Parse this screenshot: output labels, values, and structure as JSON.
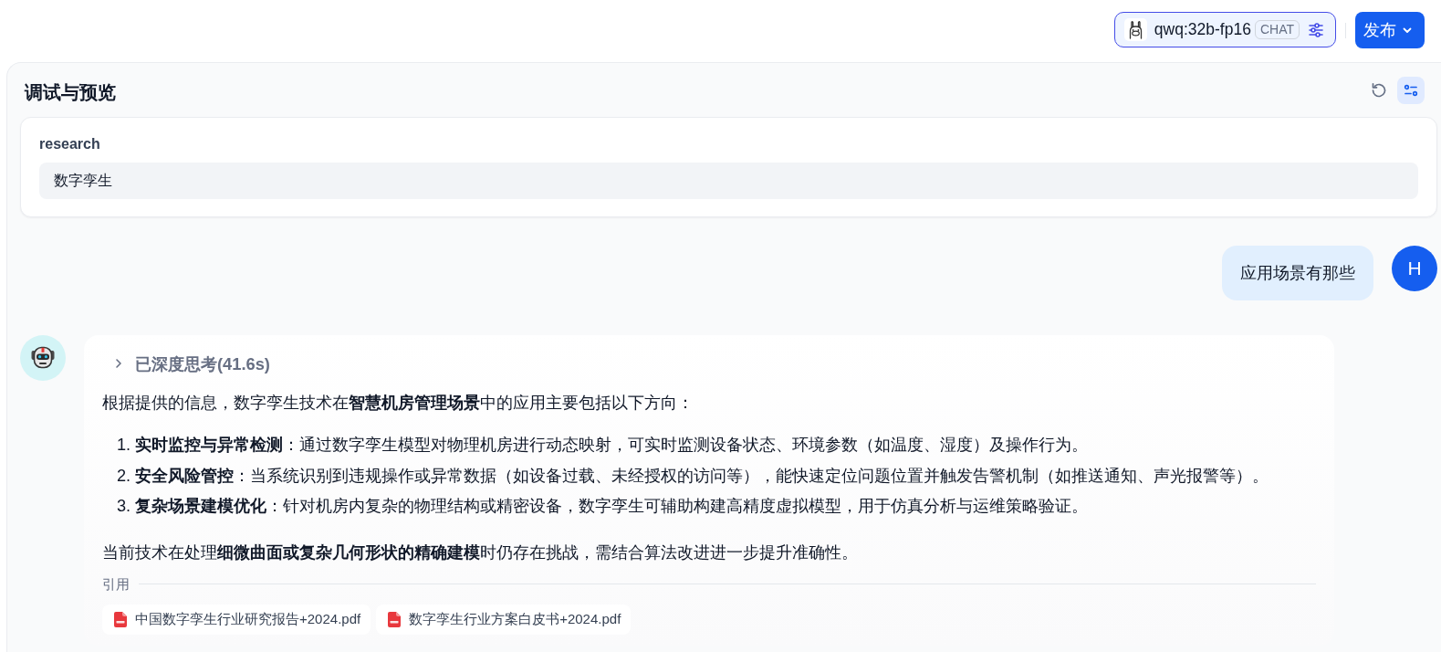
{
  "top_bar": {
    "model_selector": {
      "model": "qwq:32b-fp16",
      "mode": "CHAT"
    },
    "publish_button": "发布"
  },
  "panel": {
    "title": "调试与预览"
  },
  "variables": [
    {
      "name": "research",
      "value": "数字孪生"
    }
  ],
  "messages": [
    {
      "kind": "user",
      "avatar": "H",
      "text": "应用场景有那些"
    },
    {
      "kind": "assistant",
      "thinking": {
        "label": "已深度思考(41.6s)",
        "expanded": false
      },
      "blocks": [
        {
          "kind": "paragraph",
          "text": "根据提供的信息，数字孪生技术在**智慧机房管理场景**中的应用主要包括以下方向："
        },
        {
          "kind": "ordered_list",
          "items": [
            {
              "number": "1.",
              "text": "**实时监控与异常检测**：通过数字孪生模型对物理机房进行动态映射，可实时监测设备状态、环境参数（如温度、湿度）及操作行为。"
            },
            {
              "number": "2.",
              "text": "**安全风险管控**：当系统识别到违规操作或异常数据（如设备过载、未经授权的访问等），能快速定位问题位置并触发告警机制（如推送通知、声光报警等）。"
            },
            {
              "number": "3.",
              "text": "**复杂场景建模优化**：针对机房内复杂的物理结构或精密设备，数字孪生可辅助构建高精度虚拟模型，用于仿真分析与运维策略验证。"
            }
          ]
        },
        {
          "kind": "paragraph",
          "text": "当前技术在处理**细微曲面或复杂几何形状的精确建模**时仍存在挑战，需结合算法改进进一步提升准确性。"
        }
      ],
      "citations": {
        "label": "引用",
        "files": [
          "中国数字孪生行业研究报告+2024.pdf",
          "数字孪生行业方案白皮书+2024.pdf"
        ]
      }
    }
  ]
}
